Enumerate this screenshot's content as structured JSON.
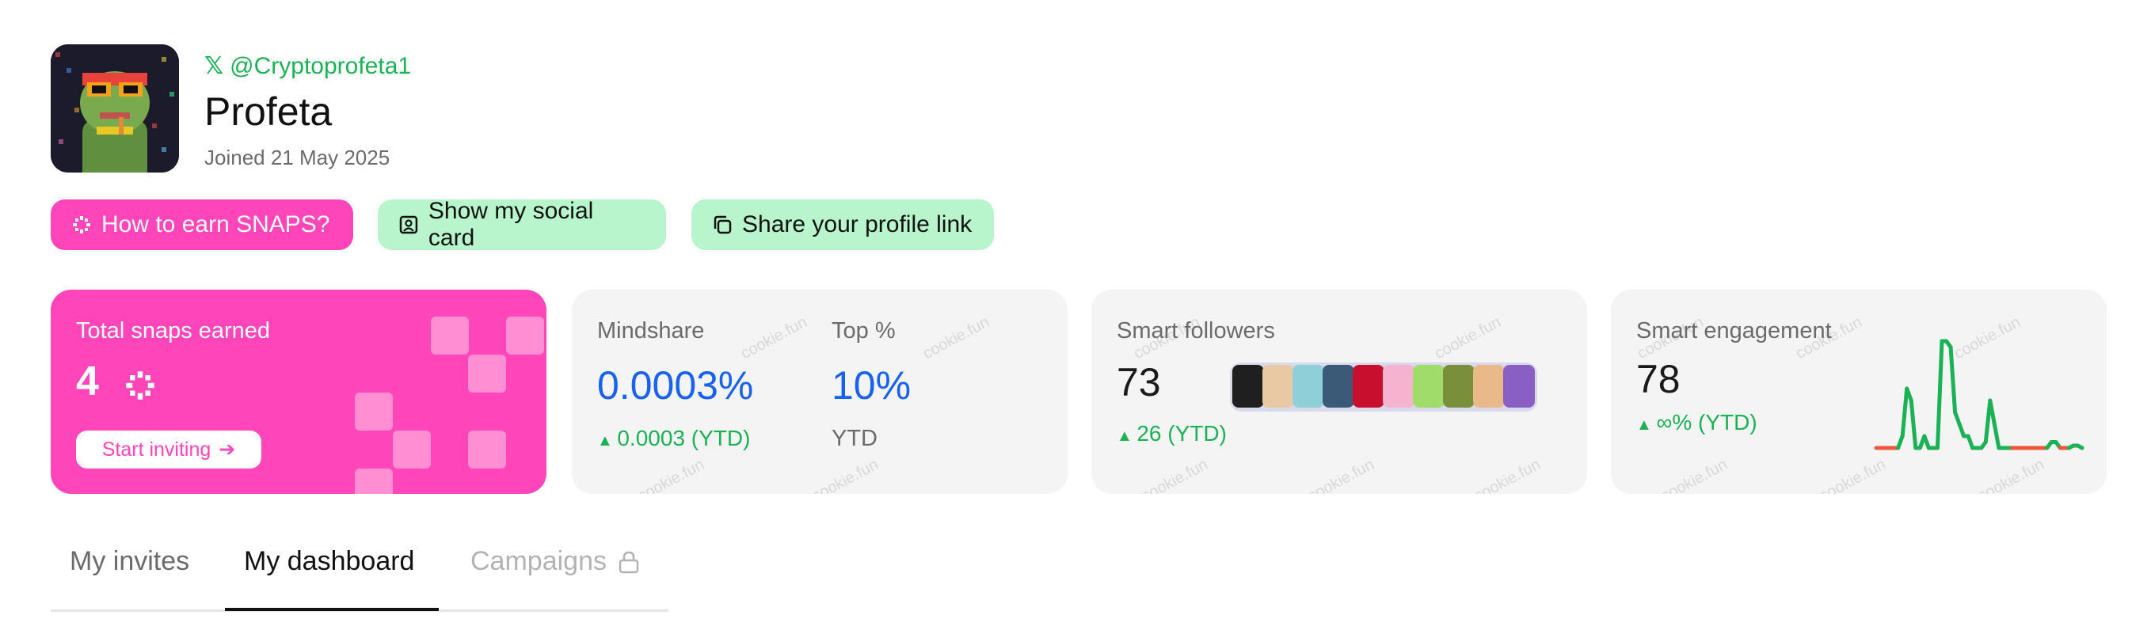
{
  "profile": {
    "handle": "@Cryptoprofeta1",
    "name": "Profeta",
    "joined": "Joined 21 May 2025"
  },
  "actions": {
    "earn": "How to earn SNAPS?",
    "social_card": "Show my social card",
    "share_link": "Share your profile link"
  },
  "snaps_card": {
    "label": "Total snaps earned",
    "value": "4",
    "invite": "Start inviting"
  },
  "mindshare": {
    "label": "Mindshare",
    "value": "0.0003%",
    "delta": "0.0003 (YTD)",
    "top_label": "Top %",
    "top_value": "10%",
    "top_sub": "YTD"
  },
  "followers": {
    "label": "Smart followers",
    "value": "73",
    "delta": "26 (YTD)"
  },
  "engagement": {
    "label": "Smart engagement",
    "value": "78",
    "delta": "∞% (YTD)"
  },
  "watermark": "cookie.fun",
  "tabs": {
    "invites": "My invites",
    "dashboard": "My dashboard",
    "campaigns": "Campaigns"
  },
  "colors": {
    "pink": "#ff45b9",
    "green": "#1ab255",
    "blue": "#1762f0",
    "mint": "#b8f5cc"
  },
  "chart_data": {
    "type": "line",
    "series": [
      {
        "values": [
          0.1,
          0.1,
          0.1,
          0.1,
          0.1,
          0.1,
          0.2,
          0.6,
          0.5,
          0.1,
          0.1,
          0.2,
          0.1,
          0.1,
          0.1,
          1.0,
          1.0,
          0.95,
          0.4,
          0.3,
          0.2,
          0.2,
          0.1,
          0.1,
          0.1,
          0.15,
          0.5,
          0.3,
          0.1,
          0.1,
          0.1,
          0.1,
          0.1,
          0.1,
          0.1,
          0.1,
          0.1,
          0.1,
          0.1,
          0.1,
          0.15,
          0.15,
          0.1,
          0.1,
          0.1,
          0.12,
          0.12,
          0.1
        ]
      }
    ],
    "segment_colors": [
      "#f0573a",
      "#1ab255"
    ],
    "title": "",
    "xlabel": "",
    "ylabel": ""
  }
}
